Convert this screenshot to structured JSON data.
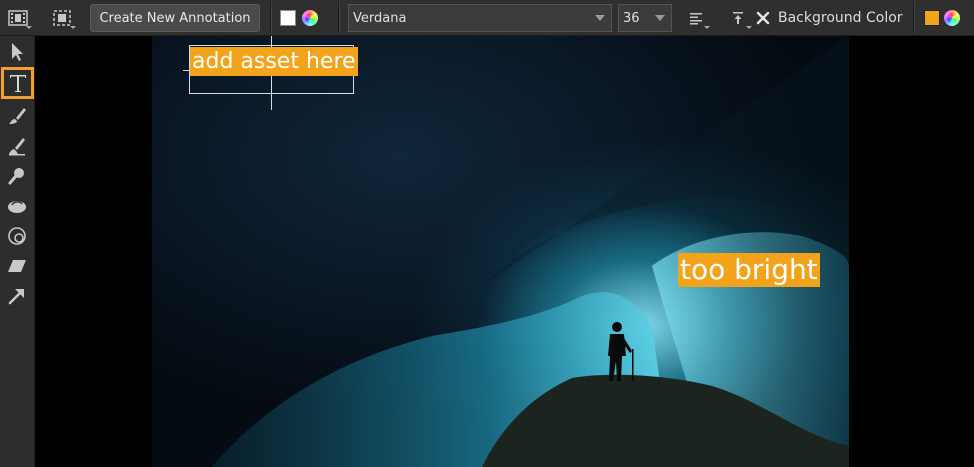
{
  "toolbar": {
    "create_button_label": "Create New Annotation",
    "text_color": "#ffffff",
    "font_family": "Verdana",
    "font_size": "36",
    "background_color_label": "Background Color",
    "background_color": "#f3a31a"
  },
  "sidebar": {
    "active_tool": "text",
    "accent_color": "#f0a030"
  },
  "annotations": [
    {
      "text": "add asset here"
    },
    {
      "text": "too bright"
    }
  ]
}
